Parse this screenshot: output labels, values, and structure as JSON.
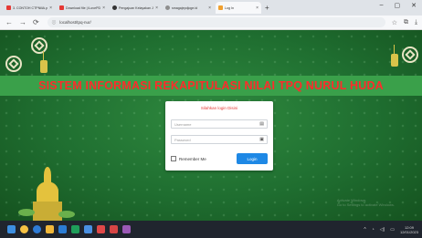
{
  "browser": {
    "tabs": [
      {
        "label": "3. CONTOH CTPNiliA.pdf",
        "icon": "pdf-icon",
        "color": "#e53935",
        "active": false
      },
      {
        "label": "Download file | iLovePDF",
        "icon": "ilovepdf-icon",
        "color": "#e53935",
        "active": false
      },
      {
        "label": "Pengajuan Kelayakan Judul",
        "icon": "github-icon",
        "color": "#333333",
        "active": false
      },
      {
        "label": "smagajepdjoge.id",
        "icon": "globe-icon",
        "color": "#8e8e8e",
        "active": false
      },
      {
        "label": "Log In",
        "icon": "site-icon",
        "color": "#f0a030",
        "active": true
      }
    ],
    "new_tab": "+",
    "url": "localhost/tpq-nur/",
    "nav": {
      "back": "←",
      "forward": "→",
      "reload": "⟳"
    }
  },
  "page": {
    "title": "SISTEM INFORMASI REKAPITULASI NILAI TPQ NURUL HUDA",
    "login": {
      "heading": "Silahkan login Disini",
      "username_placeholder": "Username",
      "password_placeholder": "Password",
      "remember_label": "Remember Me",
      "button_label": "Login"
    },
    "watermark_line1": "Activate Windows",
    "watermark_line2": "Go to Settings to activate Windows."
  },
  "taskbar": {
    "time": "12:09",
    "date": "12/01/2023"
  },
  "colors": {
    "title_band": "#3aa04a",
    "title_text": "#ff2b2b",
    "login_button": "#1e88e5",
    "taskbar": "#20252e"
  }
}
